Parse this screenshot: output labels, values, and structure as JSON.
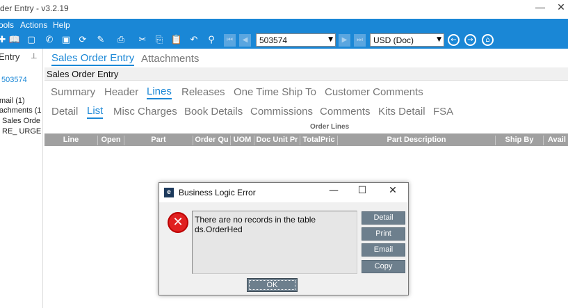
{
  "window": {
    "title": "rder Entry - v3.2.19",
    "minimize": "—",
    "close": "✕"
  },
  "menu": {
    "items": [
      "ools",
      "Actions",
      "Help"
    ]
  },
  "toolbar": {
    "order_number": "503574",
    "currency": "USD (Doc)"
  },
  "left_pane": {
    "header": "Entry",
    "pin": "📌",
    "order": "503574",
    "items": [
      "mail (1)",
      "achments (1",
      "Sales Orde",
      "RE_ URGE"
    ]
  },
  "main_tabs": {
    "items": [
      "Sales Order Entry",
      "Attachments"
    ],
    "active": 0
  },
  "section": {
    "title": "Sales Order Entry"
  },
  "sub_tabs": {
    "items": [
      "Summary",
      "Header",
      "Lines",
      "Releases",
      "One Time Ship To",
      "Customer Comments"
    ],
    "active": 2
  },
  "sub_tabs2": {
    "items": [
      "Detail",
      "List",
      "Misc Charges",
      "Book Details",
      "Commissions",
      "Comments",
      "Kits Detail",
      "FSA"
    ],
    "active": 1
  },
  "grid": {
    "title": "Order Lines",
    "columns": [
      "Line",
      "Open",
      "Part",
      "Order Qu",
      "UOM",
      "Doc Unit Pr",
      "TotalPric",
      "Part Description",
      "Ship By",
      "Avail"
    ]
  },
  "dialog": {
    "title": "Business Logic Error",
    "message_line1": "There are no records in the table",
    "message_line2": "ds.OrderHed",
    "buttons": {
      "detail": "Detail",
      "print": "Print",
      "email": "Email",
      "copy": "Copy",
      "ok": "OK"
    }
  },
  "colors": {
    "accent": "#1a87d6",
    "error": "#e02020",
    "button": "#6d7f8d"
  }
}
